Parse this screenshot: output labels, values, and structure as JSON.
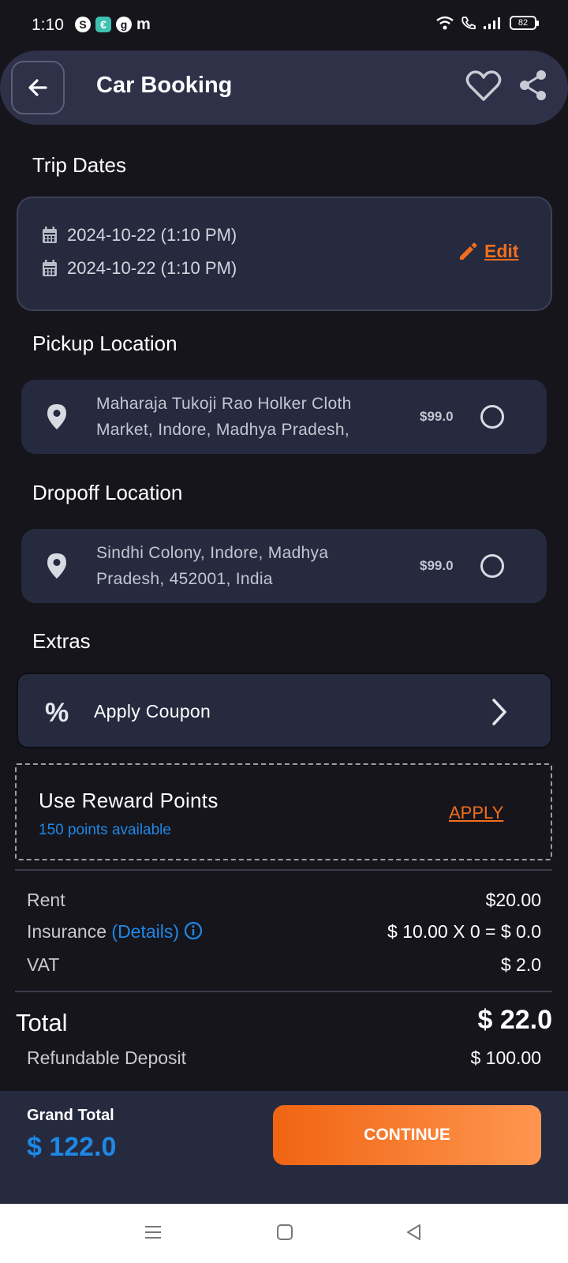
{
  "status_bar": {
    "time": "1:10",
    "app_icons": [
      "S",
      "€",
      "g",
      "m"
    ],
    "battery": "82"
  },
  "header": {
    "title": "Car Booking"
  },
  "trip_dates": {
    "title": "Trip Dates",
    "start": "2024-10-22 (1:10 PM)",
    "end": "2024-10-22 (1:10 PM)",
    "edit_label": "Edit"
  },
  "pickup": {
    "title": "Pickup Location",
    "address_line1": "Maharaja Tukoji Rao Holker Cloth",
    "address_line2": "Market, Indore, Madhya Pradesh,",
    "price": "$99.0"
  },
  "dropoff": {
    "title": "Dropoff Location",
    "address_line1": "Sindhi Colony, Indore, Madhya",
    "address_line2": "Pradesh, 452001, India",
    "price": "$99.0"
  },
  "extras": {
    "title": "Extras",
    "coupon_label": "Apply Coupon",
    "coupon_icon": "%"
  },
  "reward": {
    "title": "Use Reward Points",
    "subtitle": "150 points available",
    "apply_label": "APPLY"
  },
  "pricing": {
    "rent_label": "Rent",
    "rent_value": "$20.00",
    "insurance_label": "Insurance",
    "insurance_details": "(Details)",
    "insurance_value": "$ 10.00 X 0 = $ 0.0",
    "vat_label": "VAT",
    "vat_value": "$ 2.0",
    "total_label": "Total",
    "total_value": "$ 22.0",
    "deposit_label": "Refundable Deposit",
    "deposit_value": "$ 100.00"
  },
  "footer": {
    "grand_total_label": "Grand Total",
    "grand_total_value": "$ 122.0",
    "continue_label": "CONTINUE"
  },
  "colors": {
    "accent_orange": "#f26e1c",
    "accent_blue": "#1e88e5",
    "background": "#16151c",
    "card": "#252a3f"
  }
}
